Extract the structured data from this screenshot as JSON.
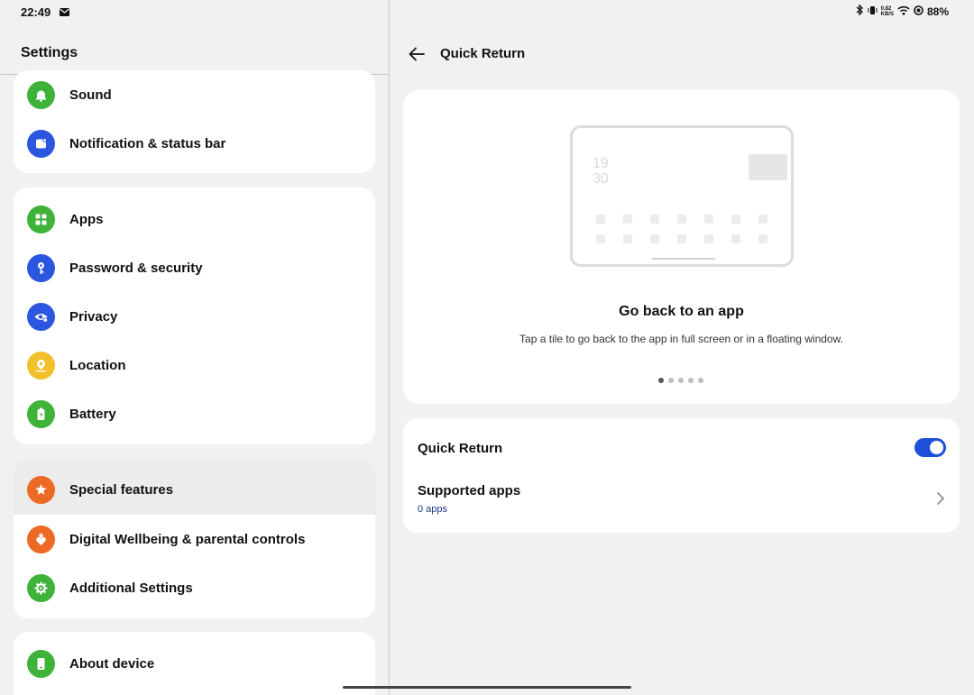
{
  "status_bar": {
    "time": "22:49",
    "net_speed_value": "0.82",
    "net_speed_unit": "KB/S",
    "battery": "88%"
  },
  "left_pane": {
    "title": "Settings",
    "groups": [
      {
        "items": [
          {
            "label": "Sound",
            "icon": "bell-icon",
            "color": "#3fb23a"
          },
          {
            "label": "Notification & status bar",
            "icon": "notification-icon",
            "color": "#2a56e0"
          }
        ]
      },
      {
        "items": [
          {
            "label": "Apps",
            "icon": "apps-grid-icon",
            "color": "#3fb23a"
          },
          {
            "label": "Password & security",
            "icon": "key-icon",
            "color": "#2a56e0"
          },
          {
            "label": "Privacy",
            "icon": "eye-lock-icon",
            "color": "#2a56e0"
          },
          {
            "label": "Location",
            "icon": "location-pin-icon",
            "color": "#f2c02a"
          },
          {
            "label": "Battery",
            "icon": "battery-icon",
            "color": "#3fb23a"
          }
        ]
      },
      {
        "items": [
          {
            "label": "Special features",
            "icon": "star-icon",
            "color": "#ec6a25",
            "active": true
          },
          {
            "label": "Digital Wellbeing & parental controls",
            "icon": "heart-person-icon",
            "color": "#ec6a25"
          },
          {
            "label": "Additional Settings",
            "icon": "gear-icon",
            "color": "#3fb23a"
          }
        ]
      },
      {
        "items": [
          {
            "label": "About device",
            "icon": "phone-icon",
            "color": "#3fb23a"
          }
        ]
      }
    ]
  },
  "right_pane": {
    "title": "Quick Return",
    "illustration": {
      "clock_hour": "19",
      "clock_minute": "30"
    },
    "demo_title": "Go back to an app",
    "demo_description": "Tap a tile to go back to the app in full screen or in a floating window.",
    "pager": {
      "count": 5,
      "active_index": 0
    },
    "quick_return": {
      "label": "Quick Return",
      "enabled": true
    },
    "supported_apps": {
      "label": "Supported apps",
      "value": "0 apps"
    },
    "accent_color": "#1e4fd9"
  }
}
